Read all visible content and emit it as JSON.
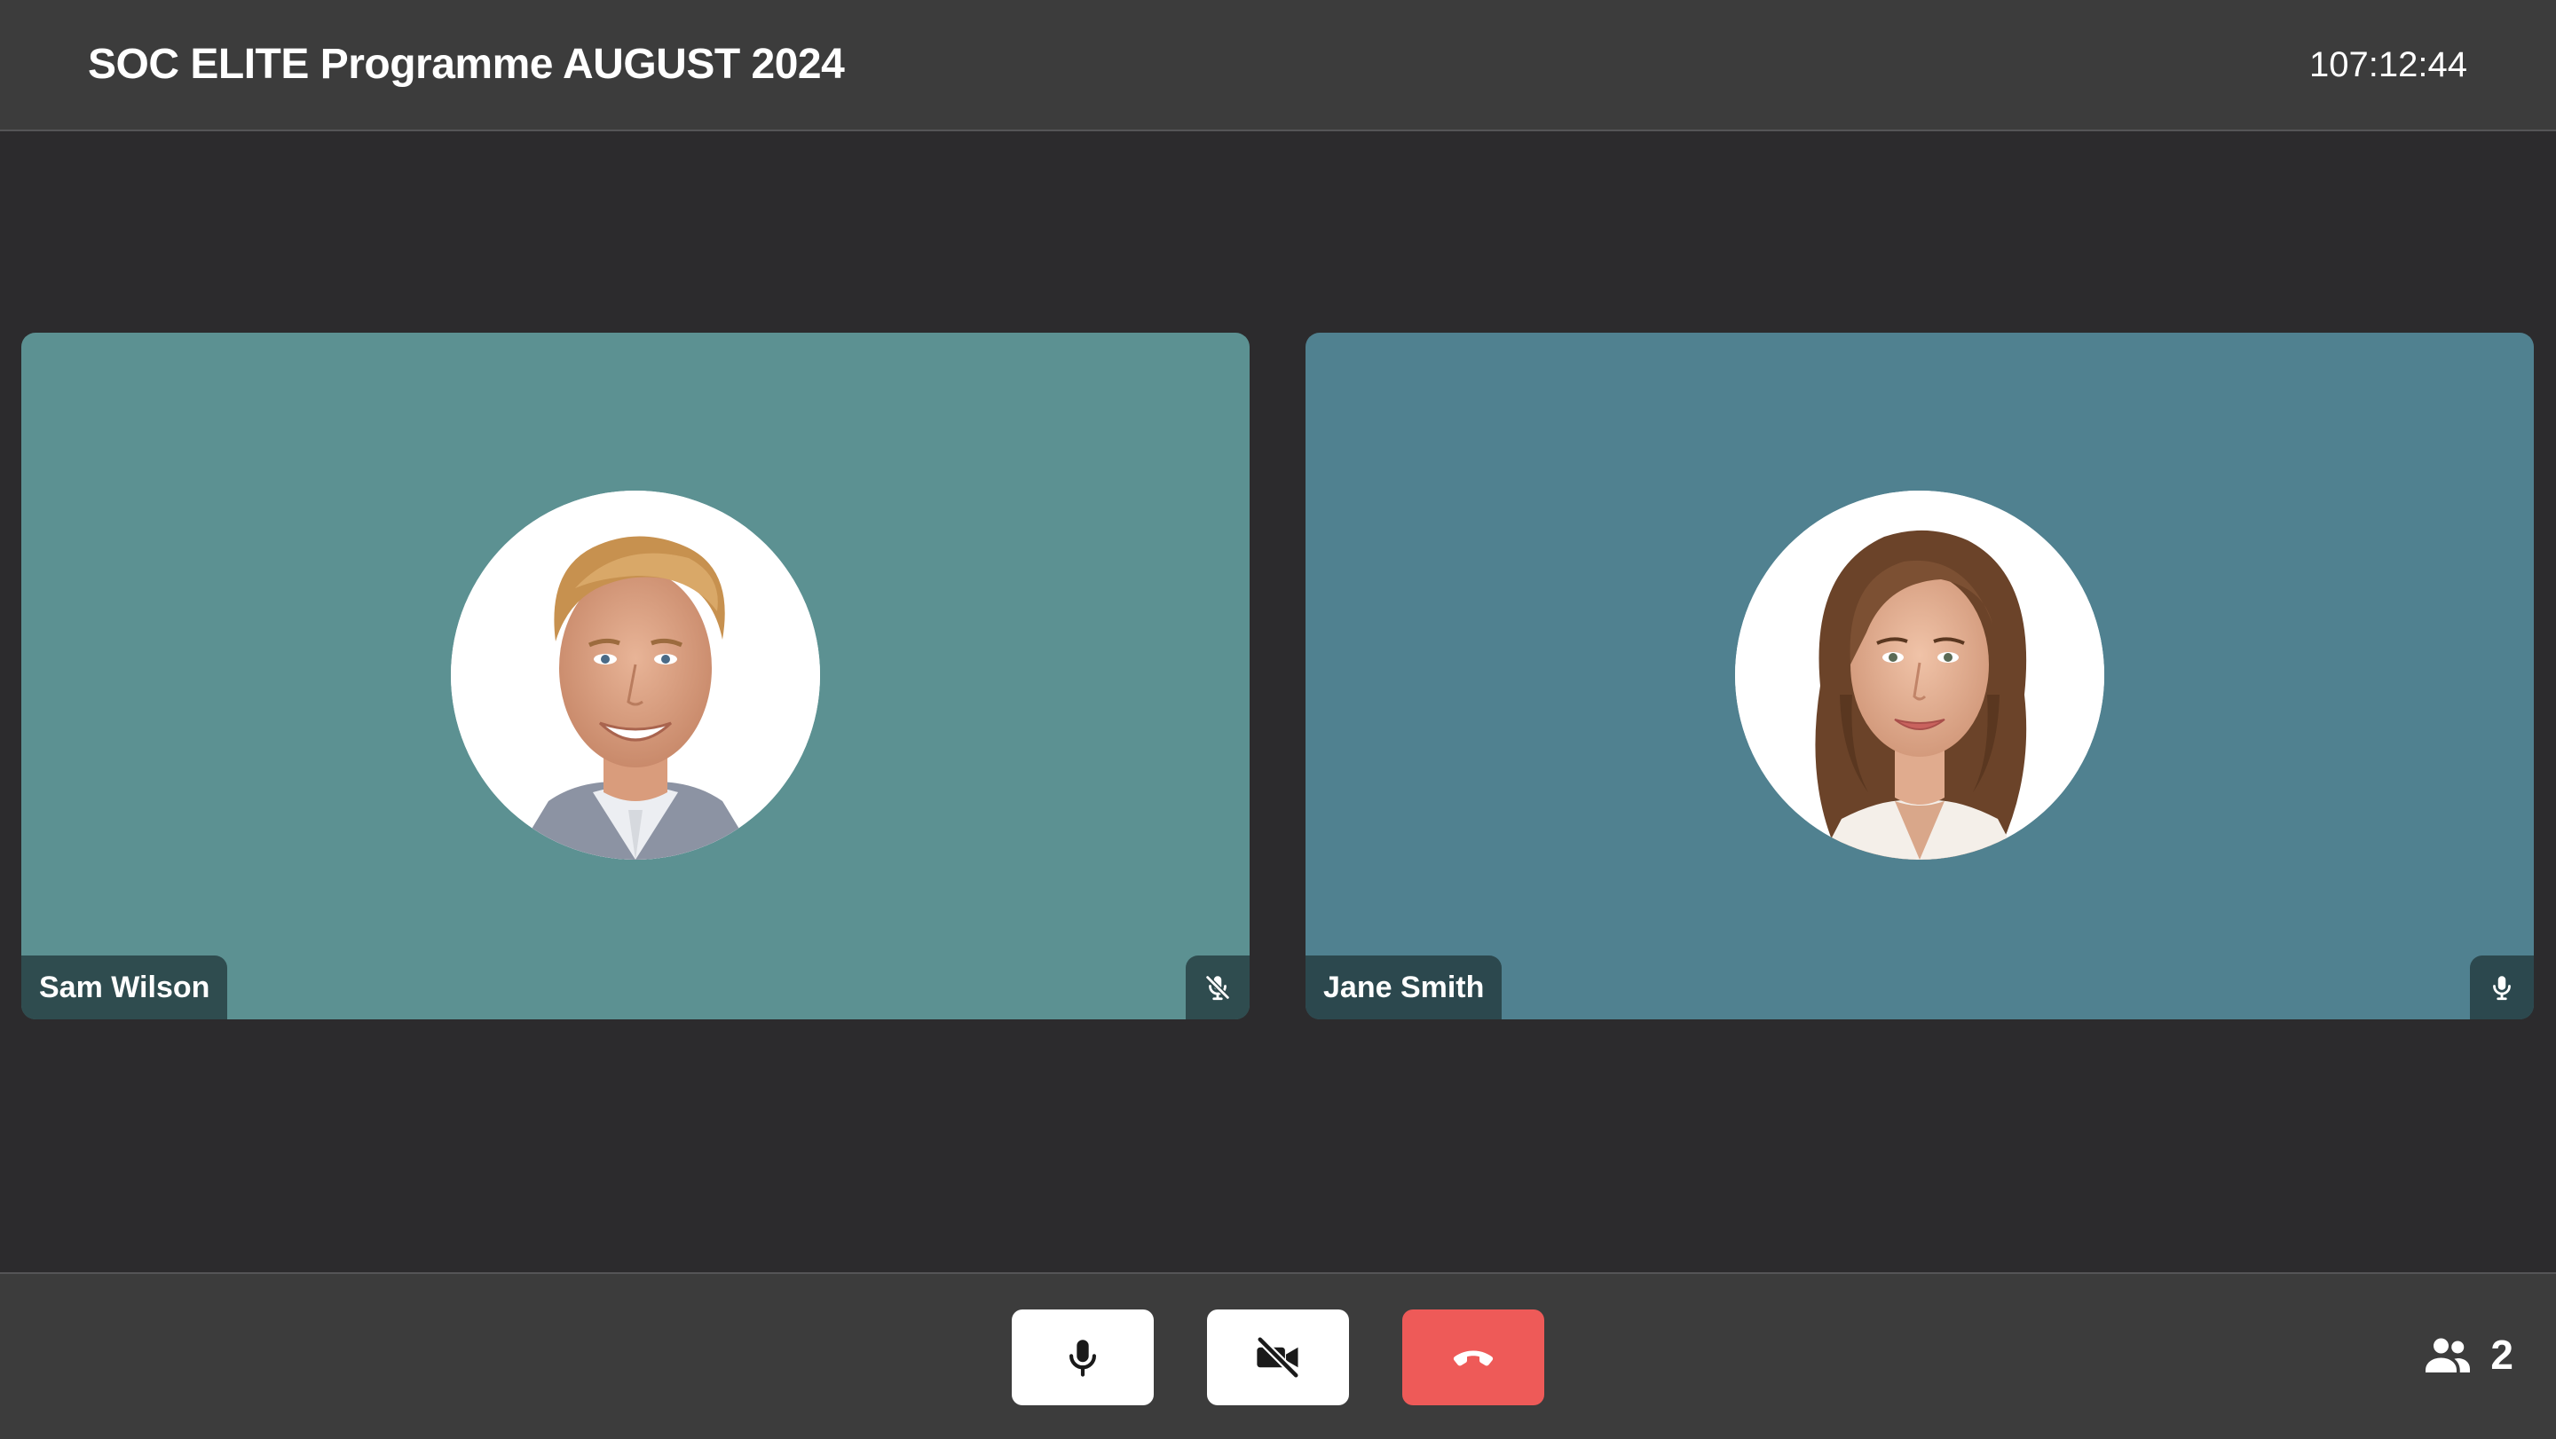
{
  "header": {
    "title": "SOC ELITE Programme AUGUST 2024",
    "timer": "107:12:44"
  },
  "participants": [
    {
      "name": "Sam Wilson",
      "tile_color": "#5c9192",
      "mic_state": "muted",
      "mic_icon": "mic-off-icon"
    },
    {
      "name": "Jane Smith",
      "tile_color": "#508190",
      "mic_state": "unmuted",
      "mic_icon": "mic-icon"
    }
  ],
  "controls": {
    "mic_button_icon": "mic-icon",
    "camera_button_icon": "video-off-icon",
    "end_call_button_icon": "phone-hangup-icon",
    "end_call_color": "#ee5a58",
    "button_color": "#ffffff"
  },
  "participant_count": {
    "icon": "people-icon",
    "value": "2"
  }
}
